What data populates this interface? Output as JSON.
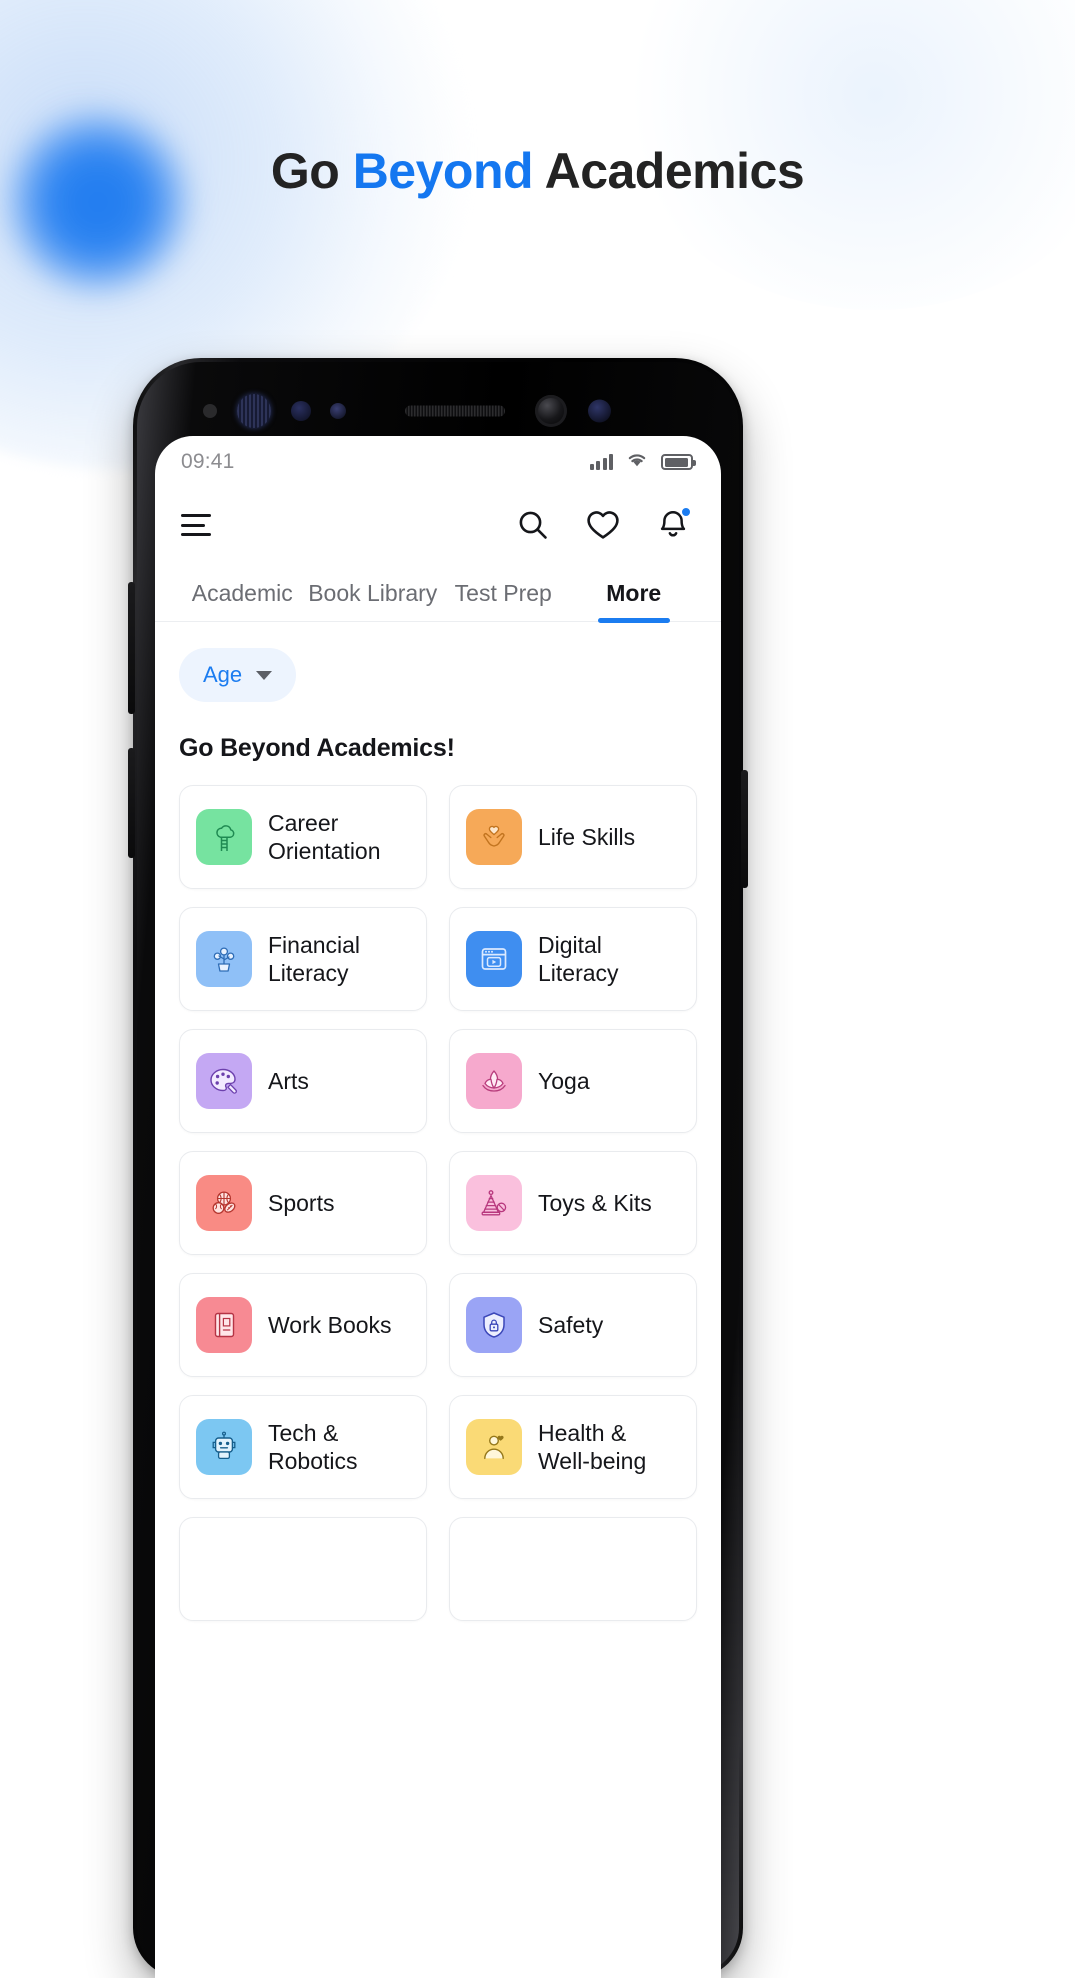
{
  "page": {
    "headline_part1": "Go ",
    "headline_accent": "Beyond",
    "headline_part2": " Academics",
    "accent_color": "#1477f0"
  },
  "status_bar": {
    "time": "09:41",
    "signal_icon": "cellular-signal-icon",
    "wifi_icon": "wifi-icon",
    "battery_icon": "battery-icon"
  },
  "nav_bar": {
    "menu_icon": "hamburger-menu-icon",
    "search_icon": "search-icon",
    "wishlist_icon": "heart-icon",
    "notifications_icon": "bell-icon",
    "notification_badge": true,
    "badge_color": "#1b7cf0"
  },
  "tabs": [
    {
      "label": "Academic",
      "active": false
    },
    {
      "label": "Book Library",
      "active": false
    },
    {
      "label": "Test Prep",
      "active": false
    },
    {
      "label": "More",
      "active": true
    }
  ],
  "filter": {
    "label": "Age",
    "caret_icon": "chevron-down-icon",
    "text_color": "#1b7cf0",
    "background_color": "#edf4fe"
  },
  "section": {
    "title": "Go Beyond Academics!"
  },
  "categories": [
    {
      "label": "Career Orientation",
      "icon": "tree-ladder-icon",
      "color": "#76e3a0"
    },
    {
      "label": "Life Skills",
      "icon": "hands-heart-icon",
      "color": "#f6a958"
    },
    {
      "label": "Financial Literacy",
      "icon": "money-plant-icon",
      "color": "#8fc0f7"
    },
    {
      "label": "Digital Literacy",
      "icon": "browser-play-icon",
      "color": "#3f8ef0"
    },
    {
      "label": "Arts",
      "icon": "paint-palette-icon",
      "color": "#c4a8f3"
    },
    {
      "label": "Yoga",
      "icon": "lotus-flower-icon",
      "color": "#f6a9cd"
    },
    {
      "label": "Sports",
      "icon": "sports-balls-icon",
      "color": "#f98b84"
    },
    {
      "label": "Toys & Kits",
      "icon": "stacking-rings-icon",
      "color": "#fac0dd"
    },
    {
      "label": "Work Books",
      "icon": "workbook-icon",
      "color": "#f78a93"
    },
    {
      "label": "Safety",
      "icon": "shield-lock-icon",
      "color": "#9aa4f5"
    },
    {
      "label": "Tech & Robotics",
      "icon": "robot-icon",
      "color": "#7cc7f2"
    },
    {
      "label": "Health & Well-being",
      "icon": "person-wellness-icon",
      "color": "#fada76"
    }
  ]
}
